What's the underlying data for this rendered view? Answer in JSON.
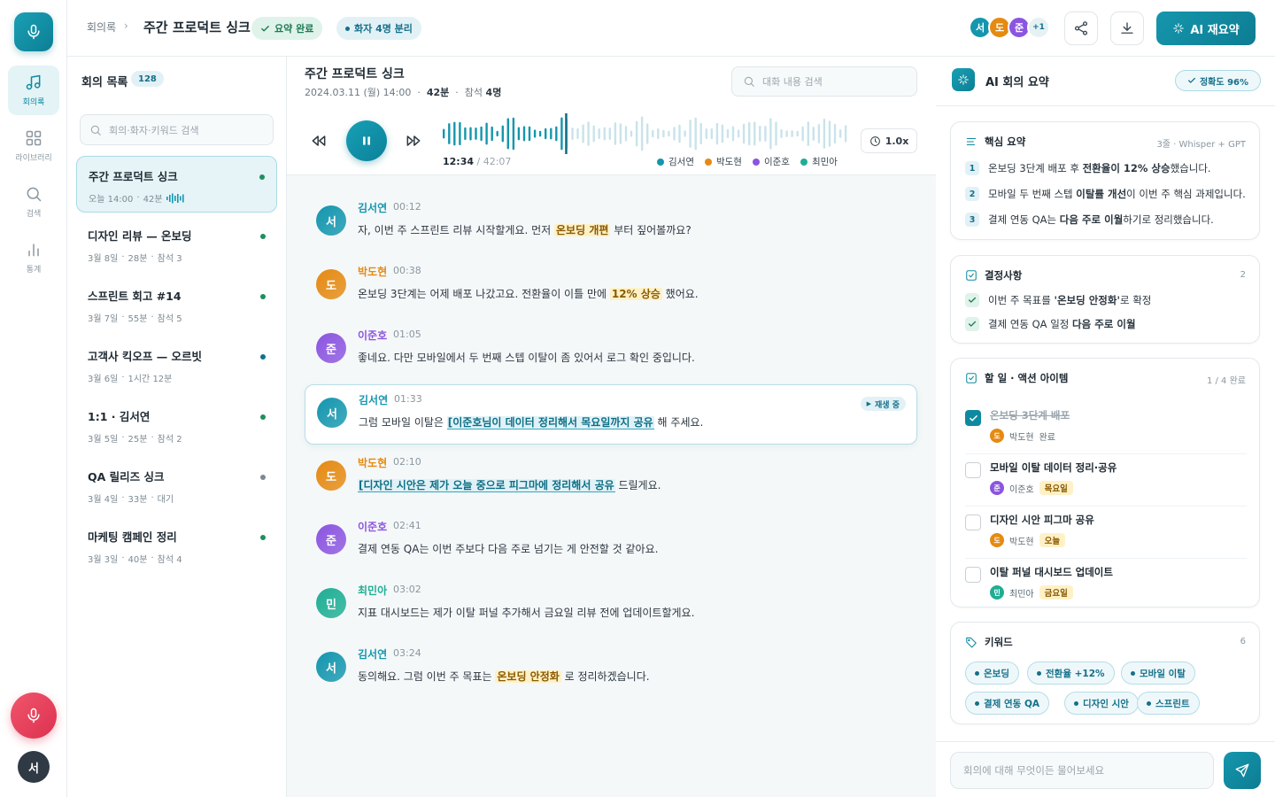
{
  "colors": {
    "accent": "#0e8aa0",
    "seoyeon": "#1496ae",
    "dohyun": "#e58a12",
    "junho": "#8b55e0",
    "mina": "#1fae94",
    "record": "#e5405c"
  },
  "rail": {
    "user_initial": "서",
    "nav": [
      {
        "label": "회의록",
        "icon": "music-note-icon",
        "active": true
      },
      {
        "label": "라이브러리",
        "icon": "grid-icon",
        "active": false
      },
      {
        "label": "검색",
        "icon": "search-icon",
        "active": false
      },
      {
        "label": "통계",
        "icon": "bar-chart-icon",
        "active": false
      }
    ]
  },
  "header": {
    "breadcrumb": "회의록",
    "title": "주간 프로덕트 싱크",
    "badge_summary": "요약 완료",
    "badge_speakers": "화자 4명 분리",
    "participants": [
      "서",
      "도",
      "준"
    ],
    "participants_more": "+1",
    "ai_button": "AI 재요약"
  },
  "meeting_list": {
    "title": "회의 목록",
    "count": "128",
    "search_placeholder": "회의·화자·키워드 검색",
    "items": [
      {
        "title": "주간 프로덕트 싱크",
        "date": "오늘 14:00",
        "duration": "42분",
        "extra": "",
        "status": "green"
      },
      {
        "title": "디자인 리뷰 — 온보딩",
        "date": "3월 8일",
        "duration": "28분",
        "extra": "참석 3",
        "status": "green"
      },
      {
        "title": "스프린트 회고 #14",
        "date": "3월 7일",
        "duration": "55분",
        "extra": "참석 5",
        "status": "green"
      },
      {
        "title": "고객사 킥오프 — 오르빗",
        "date": "3월 6일",
        "duration": "1시간 12분",
        "extra": "",
        "status": "teal"
      },
      {
        "title": "1:1 · 김서연",
        "date": "3월 5일",
        "duration": "25분",
        "extra": "참석 2",
        "status": "green"
      },
      {
        "title": "QA 릴리즈 싱크",
        "date": "3월 4일",
        "duration": "33분",
        "extra": "대기",
        "status": "gray"
      },
      {
        "title": "마케팅 캠페인 정리",
        "date": "3월 3일",
        "duration": "40분",
        "extra": "참석 4",
        "status": "green"
      }
    ]
  },
  "transcript": {
    "title": "주간 프로덕트 싱크",
    "date": "2024.03.11 (월) 14:00",
    "duration": "42분",
    "attendees_label": "참석",
    "attendees": "4명",
    "search_placeholder": "대화 내용 검색",
    "player": {
      "current": "12:34",
      "total": "/ 42:07",
      "speed": "1.0x",
      "progress": 0.3
    },
    "legend": [
      "김서연",
      "박도현",
      "이준호",
      "최민아"
    ],
    "playing_label": "재생 중",
    "utterances": [
      {
        "initial": "서",
        "name": "김서연",
        "time": "00:12",
        "color": "seoyeon",
        "pre": "자, 이번 주 스프린트 리뷰 시작할게요. 먼저 ",
        "hl": "온보딩 개편",
        "hl_type": "y",
        "post": " 부터 짚어볼까요?",
        "current": false
      },
      {
        "initial": "도",
        "name": "박도현",
        "time": "00:38",
        "color": "dohyun",
        "pre": "온보딩 3단계는 어제 배포 나갔고요. 전환율이 이틀 만에 ",
        "hl": "12% 상승",
        "hl_type": "y",
        "post": " 했어요.",
        "current": false
      },
      {
        "initial": "준",
        "name": "이준호",
        "time": "01:05",
        "color": "junho",
        "pre": "좋네요. 다만 모바일에서 두 번째 스텝 이탈이 좀 있어서 로그 확인 중입니다.",
        "hl": "",
        "hl_type": "",
        "post": "",
        "current": false
      },
      {
        "initial": "서",
        "name": "김서연",
        "time": "01:33",
        "color": "seoyeon",
        "pre": "그럼 모바일 이탈은 ",
        "hl": "[이준호님이 데이터 정리해서 목요일까지 공유",
        "hl_type": "b",
        "post": " 해 주세요.",
        "current": true
      },
      {
        "initial": "도",
        "name": "박도현",
        "time": "02:10",
        "color": "dohyun",
        "pre": "",
        "hl": "[디자인 시안은 제가 오늘 중으로 피그마에 정리해서 공유",
        "hl_type": "b",
        "post": " 드릴게요.",
        "current": false
      },
      {
        "initial": "준",
        "name": "이준호",
        "time": "02:41",
        "color": "junho",
        "pre": "결제 연동 QA는 이번 주보다 다음 주로 넘기는 게 안전할 것 같아요.",
        "hl": "",
        "hl_type": "",
        "post": "",
        "current": false
      },
      {
        "initial": "민",
        "name": "최민아",
        "time": "03:02",
        "color": "mina",
        "pre": "지표 대시보드는 제가 이탈 퍼널 추가해서 금요일 리뷰 전에 업데이트할게요.",
        "hl": "",
        "hl_type": "",
        "post": "",
        "current": false
      },
      {
        "initial": "서",
        "name": "김서연",
        "time": "03:24",
        "color": "seoyeon",
        "pre": "동의해요. 그럼 이번 주 목표는 ",
        "hl": "온보딩 안정화",
        "hl_type": "y",
        "post": " 로 정리하겠습니다.",
        "current": false
      }
    ]
  },
  "ai_panel": {
    "title": "AI 회의 요약",
    "accuracy": "정확도 96%",
    "summary": {
      "title": "핵심 요약",
      "meta": "3줄 · Whisper + GPT",
      "lines": [
        {
          "n": "1",
          "pre": "온보딩 3단계 배포 후 ",
          "bold": "전환율이 12% 상승",
          "post": "했습니다."
        },
        {
          "n": "2",
          "pre": "모바일 두 번째 스텝 ",
          "bold": "이탈률 개선",
          "post": "이 이번 주 핵심 과제입니다."
        },
        {
          "n": "3",
          "pre": "결제 연동 QA는 ",
          "bold": "다음 주로 이월",
          "post": "하기로 정리했습니다."
        }
      ]
    },
    "decisions": {
      "title": "결정사항",
      "count": "2",
      "items": [
        {
          "pre": "이번 주 목표를 ",
          "bold": "'온보딩 안정화'",
          "post": "로 확정"
        },
        {
          "pre": "결제 연동 QA 일정 ",
          "bold": "다음 주로 이월",
          "post": ""
        }
      ]
    },
    "tasks": {
      "title": "할 일 · 액션 아이템",
      "progress": "1 / 4 완료",
      "items": [
        {
          "title": "온보딩 3단계 배포",
          "initial": "도",
          "owner": "박도현",
          "tag": "완료",
          "done": true,
          "color": "dohyun"
        },
        {
          "title": "모바일 이탈 데이터 정리·공유",
          "initial": "준",
          "owner": "이준호",
          "tag": "목요일",
          "done": false,
          "color": "junho"
        },
        {
          "title": "디자인 시안 피그마 공유",
          "initial": "도",
          "owner": "박도현",
          "tag": "오늘",
          "done": false,
          "color": "dohyun"
        },
        {
          "title": "이탈 퍼널 대시보드 업데이트",
          "initial": "민",
          "owner": "최민아",
          "tag": "금요일",
          "done": false,
          "color": "mina"
        }
      ]
    },
    "keywords": {
      "title": "키워드",
      "count": "6",
      "items": [
        "온보딩",
        "전환율 +12%",
        "모바일 이탈",
        "결제 연동 QA",
        "디자인 시안",
        "스프린트"
      ]
    },
    "ask_placeholder": "회의에 대해 무엇이든 물어보세요"
  }
}
